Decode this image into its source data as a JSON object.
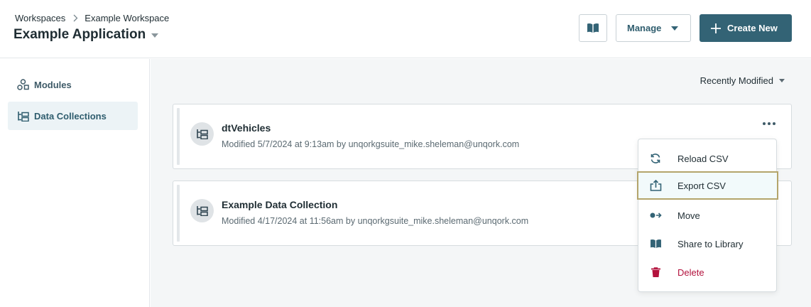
{
  "header": {
    "breadcrumb": [
      "Workspaces",
      "Example Workspace"
    ],
    "title": "Example Application",
    "manage_label": "Manage",
    "create_label": "Create New"
  },
  "sidebar": {
    "items": [
      {
        "label": "Modules",
        "icon": "modules-icon",
        "active": false
      },
      {
        "label": "Data Collections",
        "icon": "data-collections-icon",
        "active": true
      }
    ]
  },
  "main": {
    "sort_label": "Recently Modified",
    "cards": [
      {
        "name": "dtVehicles",
        "meta": "Modified 5/7/2024 at 9:13am by unqorkgsuite_mike.sheleman@unqork.com"
      },
      {
        "name": "Example Data Collection",
        "meta": "Modified 4/17/2024 at 11:56am by unqorkgsuite_mike.sheleman@unqork.com"
      }
    ]
  },
  "menu": {
    "items": [
      {
        "label": "Reload CSV",
        "icon": "reload-icon"
      },
      {
        "label": "Export CSV",
        "icon": "export-icon",
        "focused": true
      },
      {
        "label": "Move",
        "icon": "move-icon"
      },
      {
        "label": "Share to Library",
        "icon": "book-icon"
      },
      {
        "label": "Delete",
        "icon": "trash-icon",
        "danger": true
      }
    ]
  },
  "colors": {
    "primary": "#336375",
    "danger": "#b3123d",
    "focus_border": "#b4a56b",
    "active_bg": "#ecf3f6"
  }
}
